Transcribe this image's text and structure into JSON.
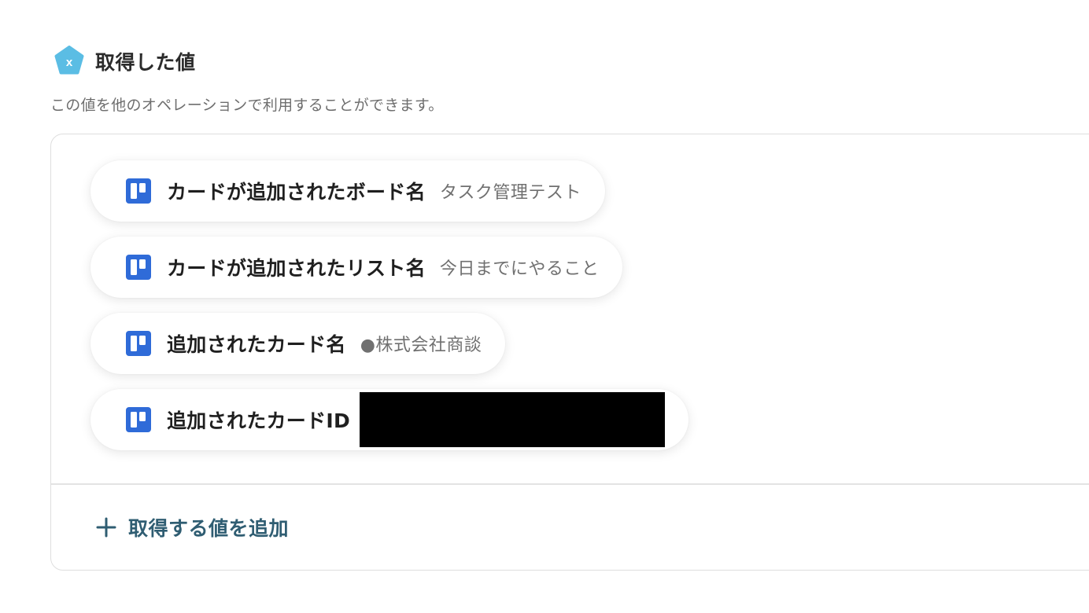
{
  "section": {
    "icon": "variable-x-icon",
    "icon_color": "#5bbde4",
    "title": "取得した値",
    "description": "この値を他のオペレーションで利用することができます。"
  },
  "values": [
    {
      "icon": "trello-icon",
      "label": "カードが追加されたボード名",
      "value": "タスク管理テスト",
      "redacted": false
    },
    {
      "icon": "trello-icon",
      "label": "カードが追加されたリスト名",
      "value": "今日までにやること",
      "redacted": false
    },
    {
      "icon": "trello-icon",
      "label": "追加されたカード名",
      "value": "●株式会社商談",
      "redacted": false
    },
    {
      "icon": "trello-icon",
      "label": "追加されたカードID",
      "value": "",
      "redacted": true
    }
  ],
  "add_button": {
    "icon": "plus-icon",
    "label": "取得する値を追加",
    "color": "#2f5d72"
  },
  "colors": {
    "trello_blue": "#2f6bd8",
    "panel_border": "#dedede"
  }
}
